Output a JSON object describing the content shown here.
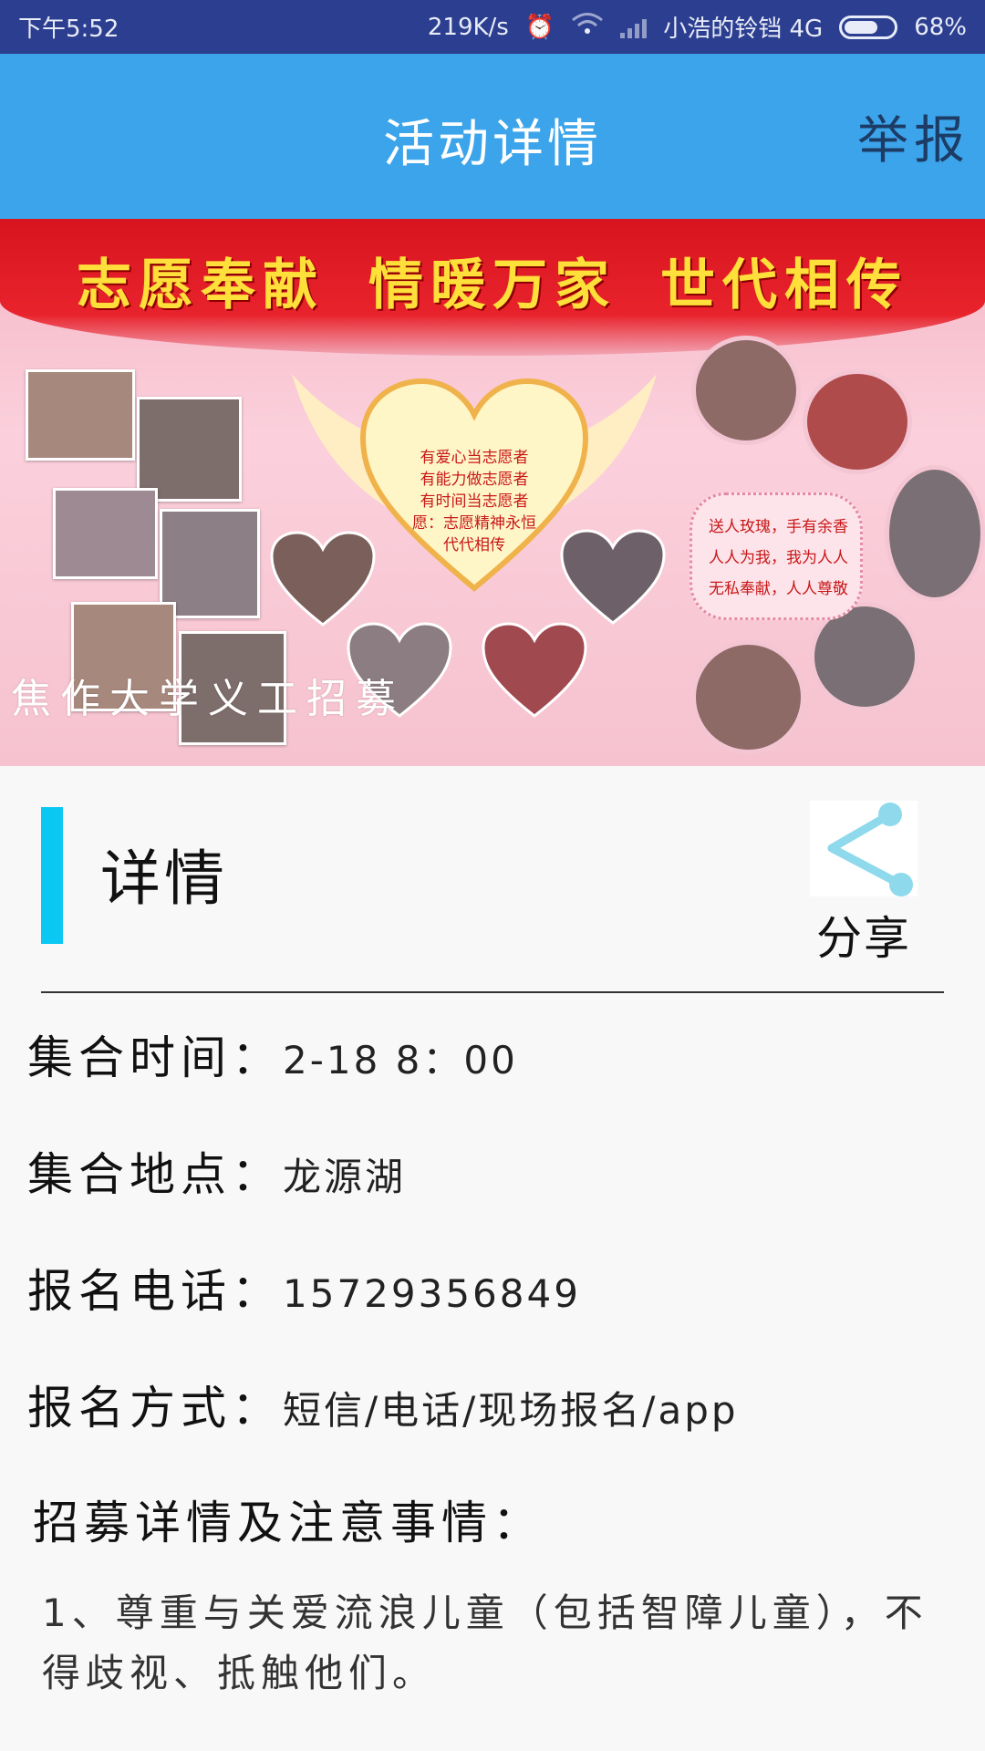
{
  "status_bar": {
    "time": "下午5:52",
    "speed": "219K/s",
    "carrier": "小浩的铃铛 4G",
    "battery": "68%",
    "battery_level": 0.68
  },
  "app_bar": {
    "title": "活动详情",
    "report_label": "举报"
  },
  "banner": {
    "slogan": [
      "志愿奉献",
      "情暖万家",
      "世代相传"
    ],
    "heart_lines": [
      "有爱心当志愿者",
      "有能力做志愿者",
      "有时间当志愿者",
      "愿：志愿精神永恒",
      "代代相传"
    ],
    "quote_lines": [
      "送人玫瑰，手有余香",
      "人人为我，我为人人",
      "无私奉献，人人尊敬"
    ],
    "caption": "焦作大学义工招募"
  },
  "section": {
    "title": "详情",
    "share_label": "分享",
    "accent_color": "#0ac8f3"
  },
  "info": [
    {
      "label": "集合时间：",
      "value": "2-18 8：00"
    },
    {
      "label": "集合地点：",
      "value": "龙源湖"
    },
    {
      "label": "报名电话：",
      "value": "15729356849"
    },
    {
      "label": "报名方式：",
      "value": "短信/电话/现场报名/app"
    }
  ],
  "notice": {
    "title": "招募详情及注意事情：",
    "text": "1、尊重与关爱流浪儿童（包括智障儿童），不得歧视、抵触他们。"
  },
  "colors": {
    "status_bar": "#2c3e8f",
    "app_bar": "#3ca4ea",
    "report": "#1c3c66"
  }
}
